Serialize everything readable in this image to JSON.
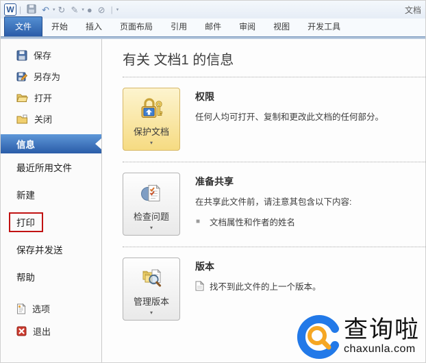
{
  "titlebar": {
    "document_label": "文档",
    "qat_icon_names": [
      "word-logo",
      "save-icon",
      "undo-icon",
      "redo-icon",
      "draw-icon",
      "globe-icon",
      "no-draw-icon",
      "customize-qat-icon"
    ]
  },
  "tabs": {
    "file": "文件",
    "others": [
      "开始",
      "插入",
      "页面布局",
      "引用",
      "邮件",
      "审阅",
      "视图",
      "开发工具"
    ]
  },
  "sidebar": {
    "save": "保存",
    "save_as": "另存为",
    "open": "打开",
    "close": "关闭",
    "info": "信息",
    "recent": "最近所用文件",
    "new": "新建",
    "print": "打印",
    "save_send": "保存并发送",
    "help": "帮助",
    "options": "选项",
    "exit": "退出"
  },
  "main": {
    "title": "有关 文档1 的信息",
    "permissions": {
      "button": "保护文档",
      "heading": "权限",
      "desc": "任何人均可打开、复制和更改此文档的任何部分。"
    },
    "prepare": {
      "button": "检查问题",
      "heading": "准备共享",
      "desc": "在共享此文件前，请注意其包含以下内容:",
      "bullet": "文档属性和作者的姓名"
    },
    "versions": {
      "button": "管理版本",
      "heading": "版本",
      "note": "找不到此文件的上一个版本。"
    }
  },
  "watermark": {
    "brand": "查询啦",
    "domain": "chaxunla.com"
  },
  "icons": {
    "dropdown": "▾",
    "undo": "↶",
    "redo": "↻",
    "pen": "✎",
    "circle": "●",
    "no_sign": "⊘",
    "bullet": "■"
  },
  "colors": {
    "accent_blue": "#2a5ca8",
    "tab_blue": "#548fd2",
    "highlight_red": "#c11212",
    "button_yellow": "#f6db82",
    "logo_blue": "#2279e8",
    "logo_orange": "#f5a623"
  }
}
